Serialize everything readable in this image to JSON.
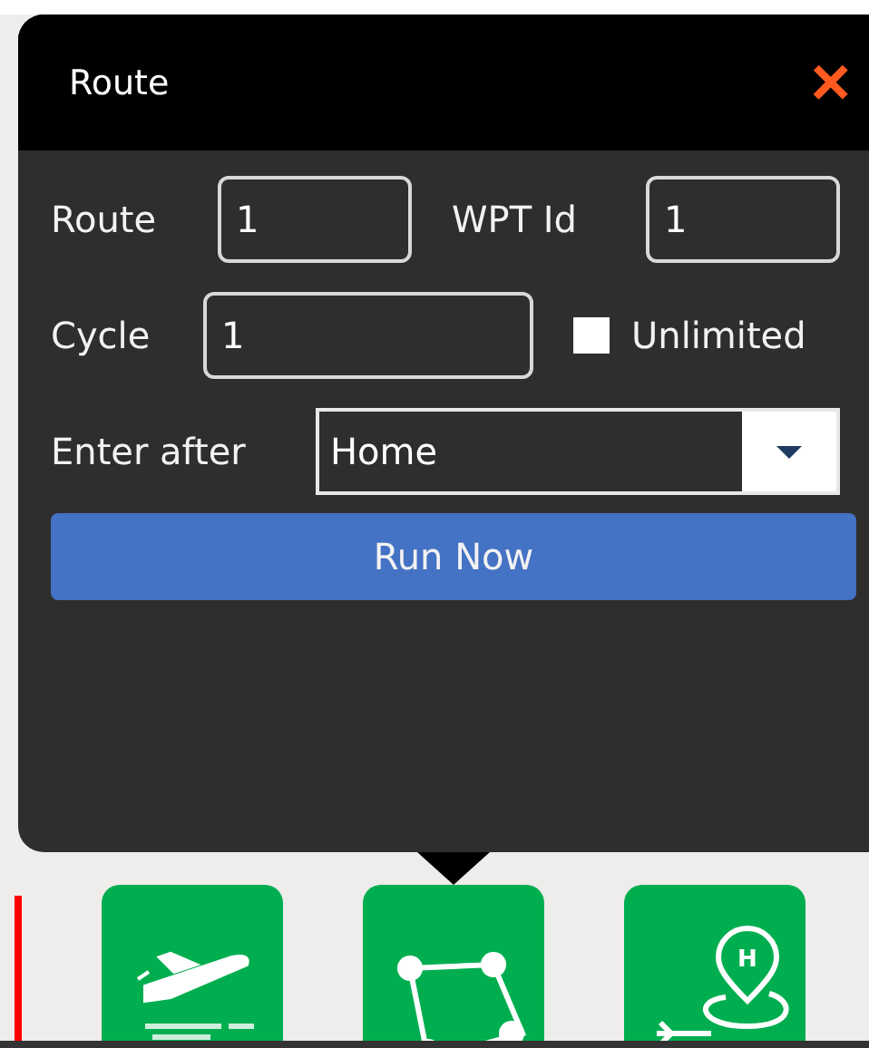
{
  "dialog": {
    "title": "Route",
    "close": "×"
  },
  "fields": [
    {
      "label": "Route",
      "value": "1"
    },
    {
      "label": "WPT Id",
      "value": "1"
    },
    {
      "label": "Cycle",
      "value": "1"
    }
  ],
  "unlimited": {
    "label": "Unlimited",
    "checked": false
  },
  "enter_after": {
    "label": "Enter after",
    "value": "Home"
  },
  "run_button": "Run Now",
  "toolbar": [
    {
      "kind": "takeoff",
      "selected": false
    },
    {
      "kind": "polygon",
      "selected": true
    },
    {
      "kind": "home",
      "selected": false,
      "icon_letter": "H"
    }
  ]
}
